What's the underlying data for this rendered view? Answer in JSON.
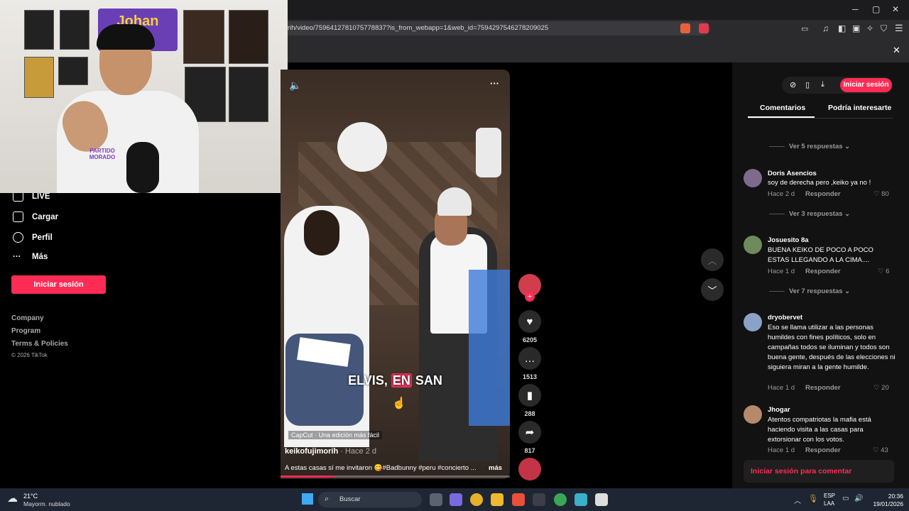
{
  "browser": {
    "url": "rih/video/7596412781075778837?is_from_webapp=1&web_id=7594297546278209025"
  },
  "left_sidebar": {
    "items": [
      {
        "label": "LIVE",
        "icon": "live-icon"
      },
      {
        "label": "Cargar",
        "icon": "upload-icon"
      },
      {
        "label": "Perfil",
        "icon": "profile-icon"
      },
      {
        "label": "Más",
        "icon": "more-icon"
      }
    ],
    "login_button": "Iniciar sesión",
    "footer": [
      "Company",
      "Program",
      "Terms & Policies",
      "© 2026 TikTok"
    ]
  },
  "webcam": {
    "banner_text": "Johan",
    "shirt_text": "PARTIDO MORADO"
  },
  "video": {
    "caption_pre": "ELVIS, ",
    "caption_highlight": "EN",
    "caption_post": " SAN",
    "capcut": "CapCut · Una edición más fácil",
    "author": "keikofujimorih",
    "author_time": " · Hace 2 d",
    "description": "A estas casas sí me invitaron 😋#Badbunny #peru #concierto ...",
    "more": "más",
    "progress": 0.23
  },
  "actions": {
    "likes": "6205",
    "comments": "1513",
    "saves": "288",
    "shares": "817"
  },
  "comments_panel": {
    "login_button": "Iniciar sesión",
    "tabs": [
      "Comentarios",
      "Podría interesarte"
    ],
    "comments": [
      {
        "more": "Ver 5 respuestas"
      },
      {
        "user": "Doris Asencios",
        "text": "soy de derecha pero ,keiko ya no !",
        "time": "Hace 2 d",
        "reply": "Responder",
        "likes": "80",
        "more": "Ver 3 respuestas"
      },
      {
        "user": "Josuesito 8a",
        "text": "BUENA KEIKO DE POCO A POCO ESTAS LLEGANDO A LA CIMA....",
        "time": "Hace 1 d",
        "reply": "Responder",
        "likes": "6",
        "more": "Ver 7 respuestas"
      },
      {
        "user": "dryobervet",
        "text": "Eso se llama utilizar a las personas humildes con fines políticos, solo en campañas todos se iluminan y todos son buena gente, después de las elecciones ni siguiera miran a la gente humilde.",
        "time": "Hace 1 d",
        "reply": "Responder",
        "likes": "20"
      },
      {
        "user": "Jhogar",
        "text": "Atentos compatriotas la mafia está haciendo visita a las casas para extorsionar con los votos.",
        "time": "Hace 1 d",
        "reply": "Responder",
        "likes": "43"
      }
    ],
    "comment_box": "Iniciar sesión para comentar"
  },
  "taskbar": {
    "temp": "21°C",
    "weather": "Mayorm. nublado",
    "search": "Buscar",
    "lang1": "ESP",
    "lang2": "LAA",
    "time": "20:36",
    "date": "19/01/2026"
  },
  "colors": {
    "accent": "#fe2c55",
    "panel": "#121212"
  }
}
